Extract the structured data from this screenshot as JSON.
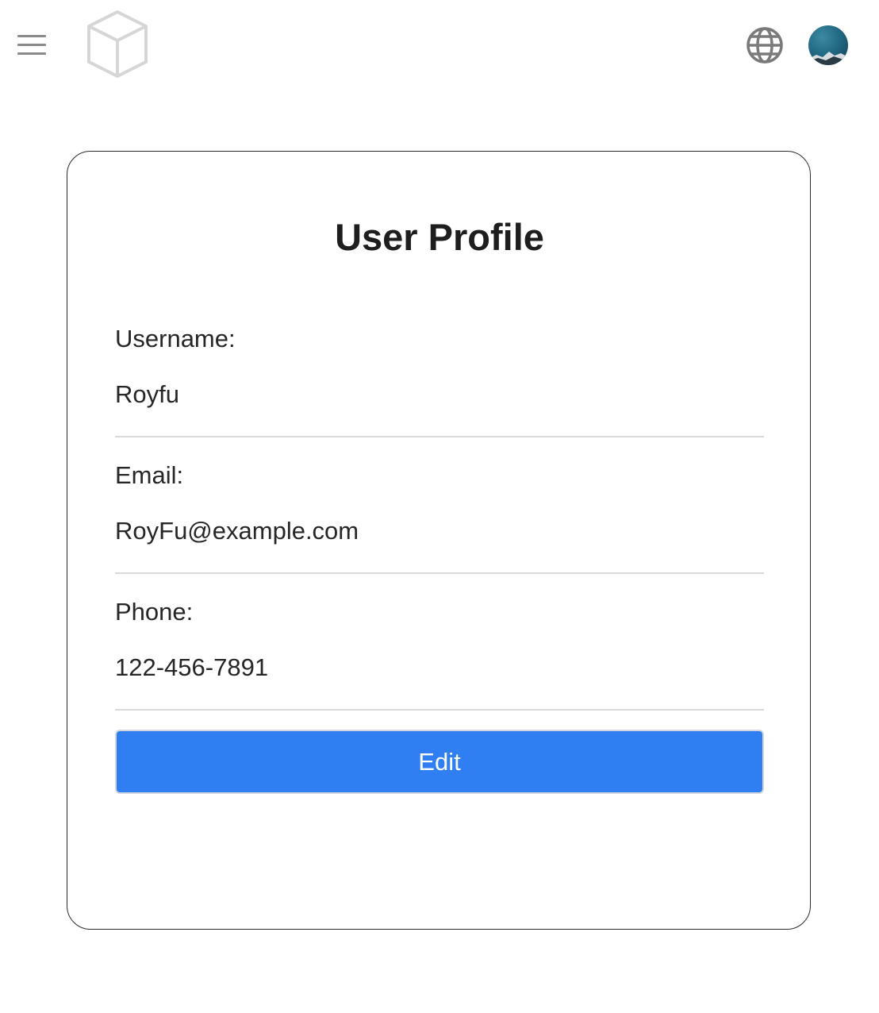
{
  "header": {
    "menu_icon": "hamburger-menu-icon",
    "logo_icon": "cube-logo-icon",
    "language_icon": "globe-icon",
    "avatar_icon": "user-avatar"
  },
  "profile": {
    "title": "User Profile",
    "fields": [
      {
        "label": "Username:",
        "value": "Royfu"
      },
      {
        "label": "Email:",
        "value": "RoyFu@example.com"
      },
      {
        "label": "Phone:",
        "value": "122-456-7891"
      }
    ],
    "edit_label": "Edit"
  },
  "colors": {
    "primary_button": "#2f7ff3",
    "card_border": "#2a2a2a",
    "divider": "#d9d9d9",
    "icon_gray": "#8a8a8a"
  }
}
